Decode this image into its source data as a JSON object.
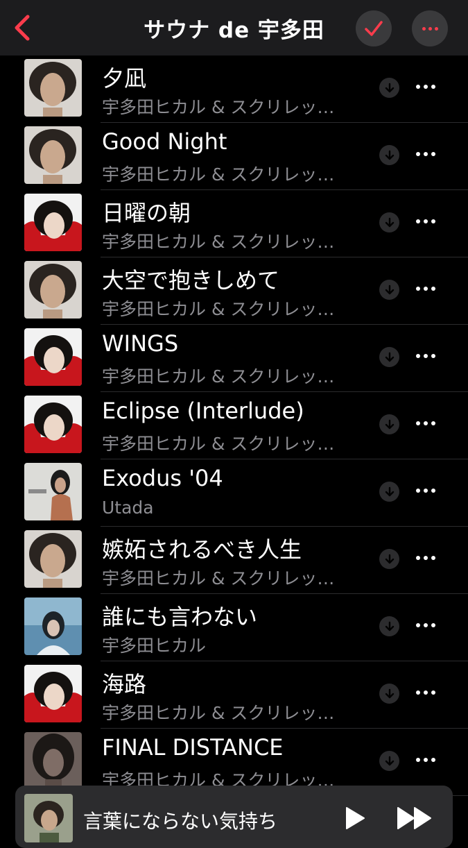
{
  "header": {
    "title": "サウナ de 宇多田",
    "accent": "#fa3c4c"
  },
  "tracks": [
    {
      "title": "夕凪",
      "artist": "宇多田ヒカル & スクリレッ…",
      "art": "portrait-white"
    },
    {
      "title": "Good Night",
      "artist": "宇多田ヒカル & スクリレッ…",
      "art": "portrait-white"
    },
    {
      "title": "日曜の朝",
      "artist": "宇多田ヒカル & スクリレッ…",
      "art": "portrait-red"
    },
    {
      "title": "大空で抱きしめて",
      "artist": "宇多田ヒカル & スクリレッ…",
      "art": "portrait-white"
    },
    {
      "title": "WINGS",
      "artist": "宇多田ヒカル & スクリレッ…",
      "art": "portrait-red"
    },
    {
      "title": "Eclipse (Interlude)",
      "artist": "宇多田ヒカル & スクリレッ…",
      "art": "portrait-red"
    },
    {
      "title": "Exodus '04",
      "artist": "Utada",
      "art": "exodus"
    },
    {
      "title": "嫉妬されるべき人生",
      "artist": "宇多田ヒカル & スクリレッ…",
      "art": "portrait-white"
    },
    {
      "title": "誰にも言わない",
      "artist": "宇多田ヒカル",
      "art": "blue-winter"
    },
    {
      "title": "海路",
      "artist": "宇多田ヒカル & スクリレッ…",
      "art": "portrait-red"
    },
    {
      "title": "FINAL DISTANCE",
      "artist": "宇多田ヒカル & スクリレッ…",
      "art": "dark-portrait"
    }
  ],
  "now_playing": {
    "title": "言葉にならない気持ち",
    "art": "now-playing"
  }
}
